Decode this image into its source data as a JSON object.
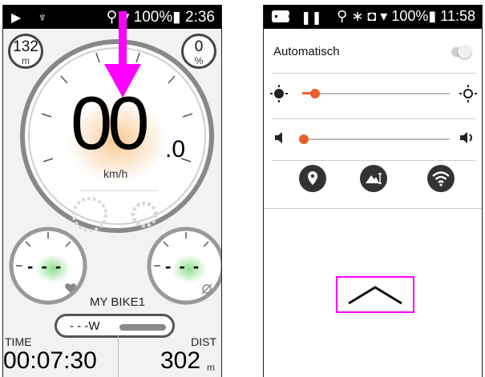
{
  "left_screen": {
    "status": {
      "battery": "100%",
      "time": "2:36"
    },
    "badges": {
      "left_value": "132",
      "left_unit": "m",
      "right_value": "0",
      "right_unit": "%"
    },
    "speed": {
      "value": "00",
      "decimal": ".0",
      "unit": "km/h"
    },
    "gauges": {
      "left_value": "- - -",
      "right_value": "- - -"
    },
    "bike_name": "MY BIKE1",
    "power": {
      "text": "- - -W"
    },
    "fields": {
      "time_label": "TIME",
      "time_value": "00:07:30",
      "dist_label": "DIST",
      "dist_value": "302",
      "dist_unit": "m"
    },
    "icons": [
      "navigation-arrow-icon",
      "pin-icon",
      "location-icon",
      "wifi-icon",
      "battery-icon",
      "heart-icon",
      "cadence-icon",
      "gear-icon"
    ]
  },
  "right_screen": {
    "status": {
      "battery": "100%",
      "time": "11:58"
    },
    "auto_brightness": {
      "label": "Automatisch",
      "enabled": false
    },
    "brightness": {
      "level": 0.07
    },
    "volume": {
      "level": 0.03
    },
    "tiles": [
      "location-icon",
      "landscape-icon",
      "wifi-icon"
    ],
    "collapse_icon": "chevron-up-icon"
  },
  "colors": {
    "accent": "#e8602c",
    "highlight": "#ff00ff",
    "statusbar": "#000000"
  }
}
